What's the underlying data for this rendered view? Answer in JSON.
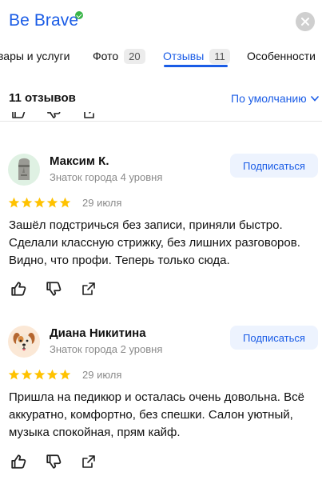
{
  "header": {
    "title": "Be Brave"
  },
  "tabs": [
    {
      "label": "вары и услуги",
      "count": ""
    },
    {
      "label": "Фото",
      "count": "20"
    },
    {
      "label": "Отзывы",
      "count": "11"
    },
    {
      "label": "Особенности",
      "count": ""
    }
  ],
  "active_tab": "Отзывы",
  "reviews_summary": {
    "count_label": "11 отзывов",
    "sort_label": "По умолчанию"
  },
  "reviews": [
    {
      "author": "Максим К.",
      "level": "Знаток города 4 уровня",
      "subscribe_label": "Подписаться",
      "rating": 5,
      "date": "29 июля",
      "text": "Зашёл подстричься без записи, приняли быстро. Сделали классную стрижку, без лишних разговоров. Видно, что профи. Теперь только сюда.",
      "avatar_icon": "moai-icon"
    },
    {
      "author": "Диана Никитина",
      "level": "Знаток города 2 уровня",
      "subscribe_label": "Подписаться",
      "rating": 5,
      "date": "29 июля",
      "text": "Пришла на педикюр и осталась очень довольна. Всё аккуратно, комфортно, без спешки. Салон уютный, музыка спокойная, прям кайф.",
      "avatar_icon": "dog-face-icon"
    }
  ],
  "colors": {
    "accent": "#1a5ce6",
    "star": "#ffc200",
    "verified": "#3bb54a",
    "muted": "#8a8a8a"
  }
}
